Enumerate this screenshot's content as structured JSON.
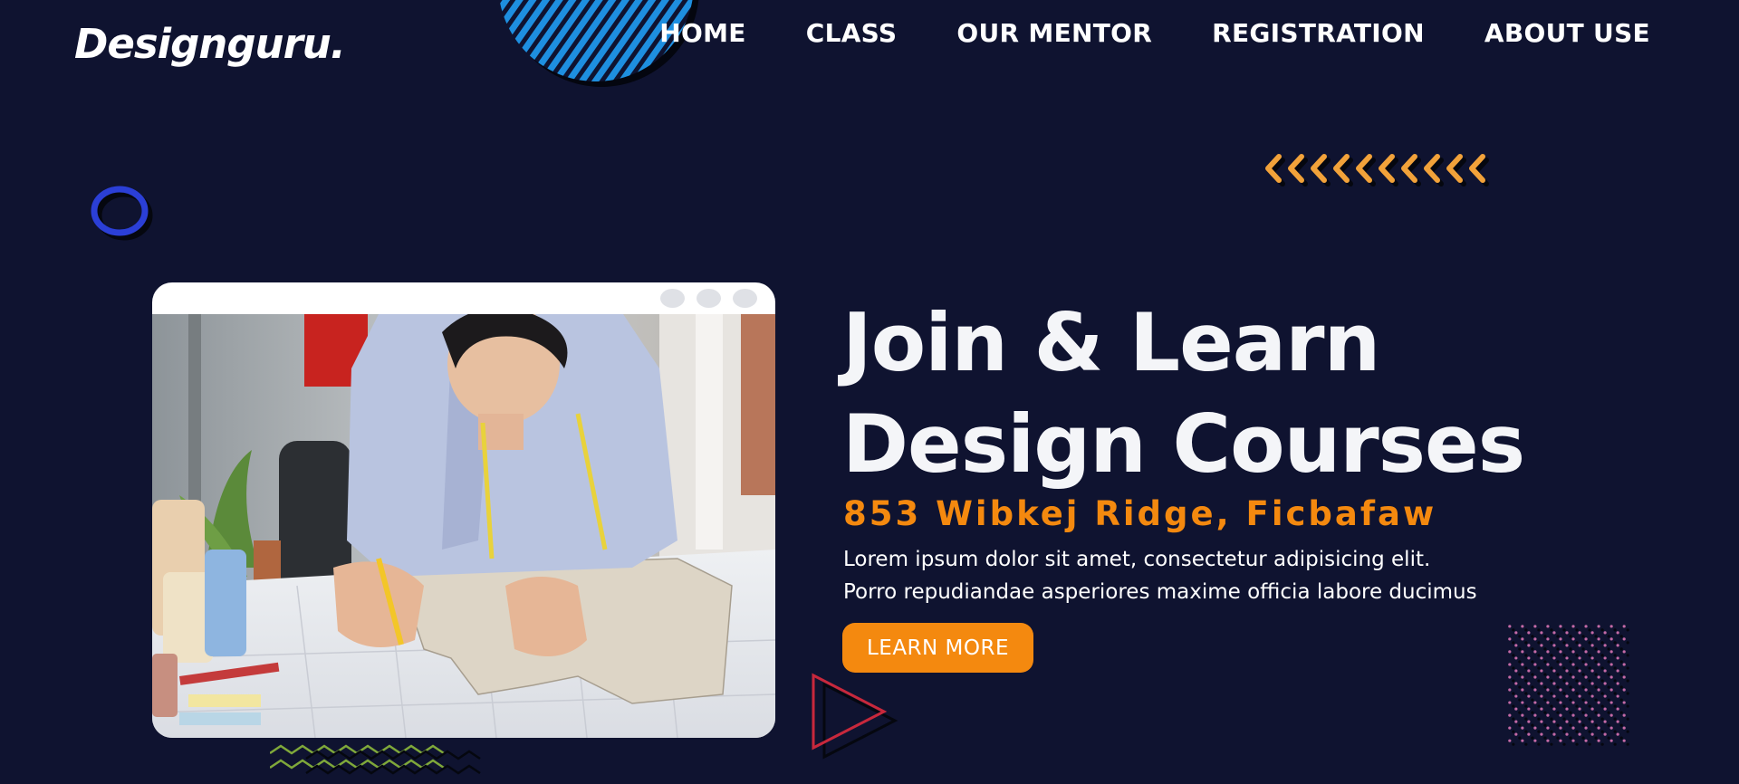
{
  "brand": {
    "logo_text": "Designguru."
  },
  "nav": {
    "items": [
      {
        "label": "HOME"
      },
      {
        "label": "CLASS"
      },
      {
        "label": "OUR MENTOR"
      },
      {
        "label": "REGISTRATION"
      },
      {
        "label": "ABOUT USE"
      }
    ]
  },
  "hero": {
    "title_line1": "Join & Learn",
    "title_line2": "Design Courses",
    "address": "853 Wibkej Ridge, Ficbafaw",
    "description_line1": "Lorem ipsum dolor sit amet, consectetur adipisicing elit.",
    "description_line2": "Porro repudiandae asperiores maxime officia labore ducimus",
    "cta_label": "LEARN MORE",
    "image_icon": "fashion-designer-photo"
  },
  "colors": {
    "background": "#0f1330",
    "accent": "#f4890f",
    "deco_blue": "#1e8fe0",
    "ring_blue": "#2b3fd6",
    "chevron_orange": "#f2a23a",
    "triangle_red": "#c8283c",
    "zigzag_green": "#7fa83a",
    "dots_pink": "#c46aa6"
  }
}
